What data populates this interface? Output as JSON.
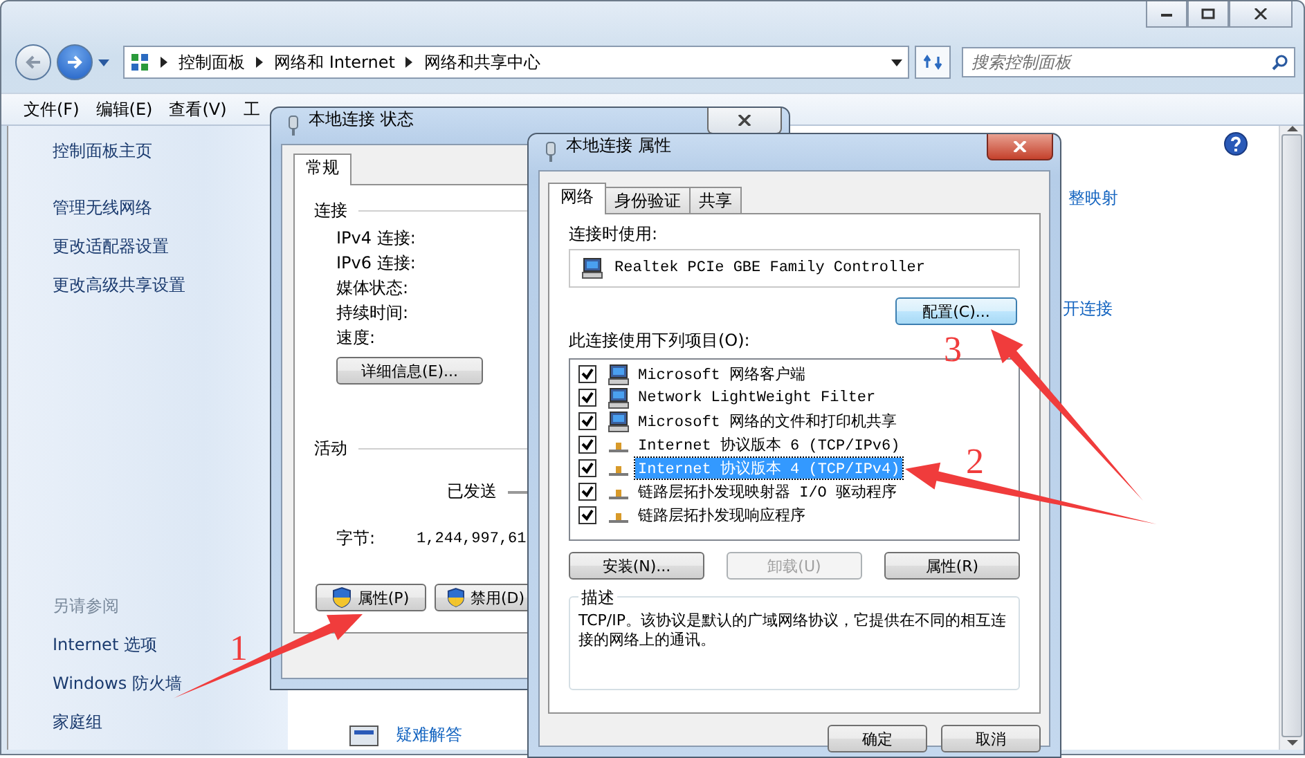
{
  "nav": {
    "breadcrumbs": [
      "控制面板",
      "网络和 Internet",
      "网络和共享中心"
    ],
    "search": {
      "placeholder": "搜索控制面板"
    }
  },
  "menu": [
    "文件(F)",
    "编辑(E)",
    "查看(V)",
    "工"
  ],
  "sidebar": {
    "links": [
      "控制面板主页",
      "管理无线网络",
      "更改适配器设置",
      "更改高级共享设置"
    ],
    "see_also_title": "另请参阅",
    "see_also": [
      "Internet 选项",
      "Windows 防火墙",
      "家庭组"
    ]
  },
  "content": {
    "links": [
      "整映射",
      "开连接"
    ],
    "troubleshoot": "疑难解答"
  },
  "status_dialog": {
    "title": "本地连接 状态",
    "tabs": [
      {
        "label": "常规",
        "selected": true
      }
    ],
    "connection_heading": "连接",
    "fields": [
      "IPv4 连接:",
      "IPv6 连接:",
      "媒体状态:",
      "持续时间:",
      "速度:"
    ],
    "details_button": "详细信息(E)...",
    "activity_heading": "活动",
    "sent_label": "已发送",
    "bytes_label": "字节:",
    "bytes_value": "1,244,997,61",
    "buttons": [
      "属性(P)",
      "禁用(D)"
    ]
  },
  "properties_dialog": {
    "title": "本地连接 属性",
    "tabs": [
      {
        "label": "网络",
        "selected": true
      },
      {
        "label": "身份验证",
        "selected": false
      },
      {
        "label": "共享",
        "selected": false
      }
    ],
    "connect_using_label": "连接时使用:",
    "adapter": "Realtek PCIe GBE Family Controller",
    "configure_button": "配置(C)...",
    "items_label": "此连接使用下列项目(O):",
    "items": [
      {
        "label": "Microsoft 网络客户端",
        "kind": "computer",
        "checked": true,
        "selected": false
      },
      {
        "label": "Network LightWeight Filter",
        "kind": "computer",
        "checked": true,
        "selected": false
      },
      {
        "label": "Microsoft 网络的文件和打印机共享",
        "kind": "computer",
        "checked": true,
        "selected": false
      },
      {
        "label": "Internet 协议版本 6 (TCP/IPv6)",
        "kind": "protocol",
        "checked": true,
        "selected": false
      },
      {
        "label": "Internet 协议版本 4 (TCP/IPv4)",
        "kind": "protocol",
        "checked": true,
        "selected": true
      },
      {
        "label": "链路层拓扑发现映射器 I/O 驱动程序",
        "kind": "protocol",
        "checked": true,
        "selected": false
      },
      {
        "label": "链路层拓扑发现响应程序",
        "kind": "protocol",
        "checked": true,
        "selected": false
      }
    ],
    "item_buttons": [
      {
        "label": "安装(N)...",
        "disabled": false
      },
      {
        "label": "卸载(U)",
        "disabled": true
      },
      {
        "label": "属性(R)",
        "disabled": false
      }
    ],
    "description_title": "描述",
    "description": "TCP/IP。该协议是默认的广域网络协议，它提供在不同的相互连接的网络上的通讯。",
    "buttons": [
      "确定",
      "取消"
    ]
  },
  "annotations": [
    {
      "label": "1"
    },
    {
      "label": "2"
    },
    {
      "label": "3"
    }
  ]
}
